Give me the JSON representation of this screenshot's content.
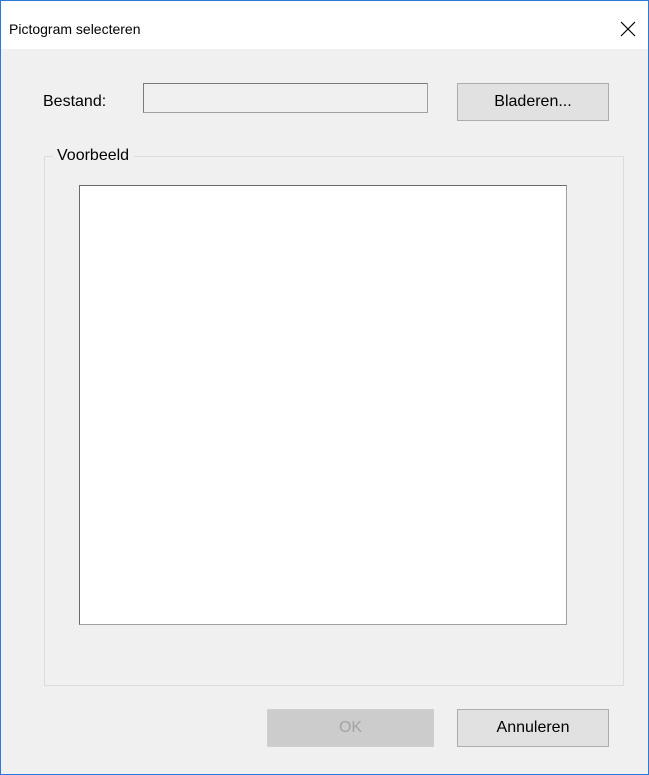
{
  "window": {
    "title": "Pictogram selecteren",
    "close_icon": "close-icon"
  },
  "file": {
    "label": "Bestand:",
    "value": "",
    "browse_label": "Bladeren..."
  },
  "preview": {
    "legend": "Voorbeeld"
  },
  "footer": {
    "ok_label": "OK",
    "ok_enabled": false,
    "cancel_label": "Annuleren"
  },
  "colors": {
    "window_border": "#2b7bd6",
    "dialog_background": "#f0f0f0",
    "button_face": "#e1e1e1"
  }
}
